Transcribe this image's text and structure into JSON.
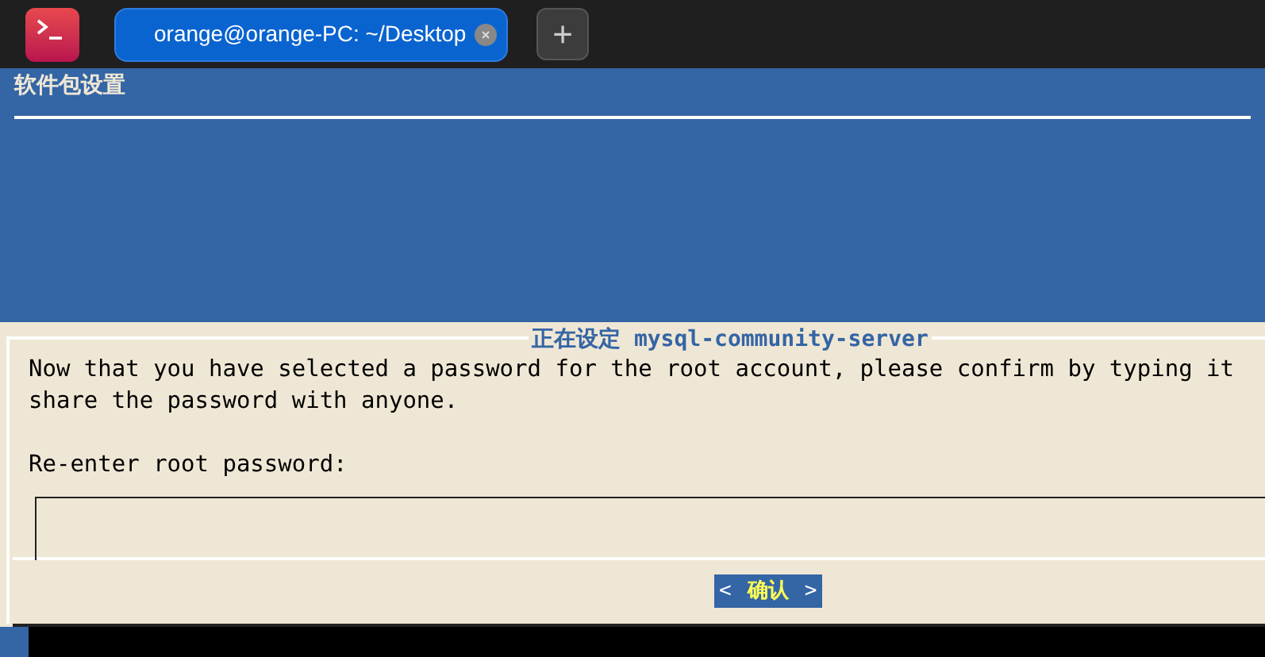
{
  "tab": {
    "title": "orange@orange-PC: ~/Desktop",
    "selected": true
  },
  "new_tab": "+",
  "header": {
    "title": "软件包设置"
  },
  "dialog": {
    "title_prefix": "正在设定",
    "title_package": "mysql-community-server",
    "message": [
      "Now that you have selected a password for the root account, please confirm by typing it",
      "share the password with anyone."
    ],
    "prompt": "Re-enter root password:",
    "button": {
      "left": "<",
      "label": "确认",
      "right": ">"
    }
  }
}
